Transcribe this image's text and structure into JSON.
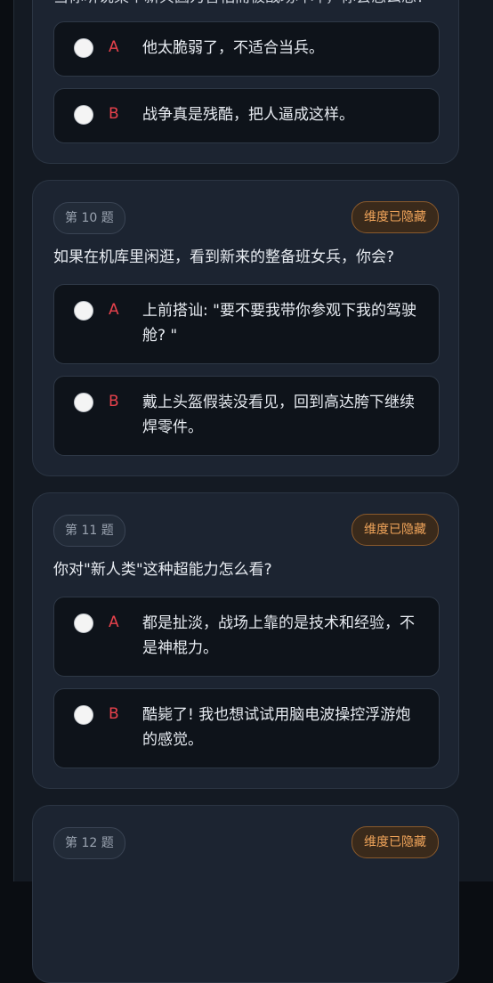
{
  "cards": [
    {
      "question_fragment": "当你听说某个新兵因为害怕而被战场吓坏，你会怎么想？",
      "options": [
        {
          "letter": "A",
          "text": "他太脆弱了，不适合当兵。"
        },
        {
          "letter": "B",
          "text": "战争真是残酷，把人逼成这样。"
        }
      ]
    },
    {
      "number": "第 10 题",
      "badge": "维度已隐藏",
      "question": "如果在机库里闲逛，看到新来的整备班女兵，你会?",
      "options": [
        {
          "letter": "A",
          "text": "上前搭讪: \"要不要我带你参观下我的驾驶舱? \""
        },
        {
          "letter": "B",
          "text": "戴上头盔假装没看见，回到高达胯下继续焊零件。"
        }
      ]
    },
    {
      "number": "第 11 题",
      "badge": "维度已隐藏",
      "question": "你对\"新人类\"这种超能力怎么看?",
      "options": [
        {
          "letter": "A",
          "text": "都是扯淡，战场上靠的是技术和经验，不是神棍力。"
        },
        {
          "letter": "B",
          "text": "酷毙了! 我也想试试用脑电波操控浮游炮的感觉。"
        }
      ]
    },
    {
      "number": "第 12 题",
      "badge": "维度已隐藏"
    }
  ]
}
